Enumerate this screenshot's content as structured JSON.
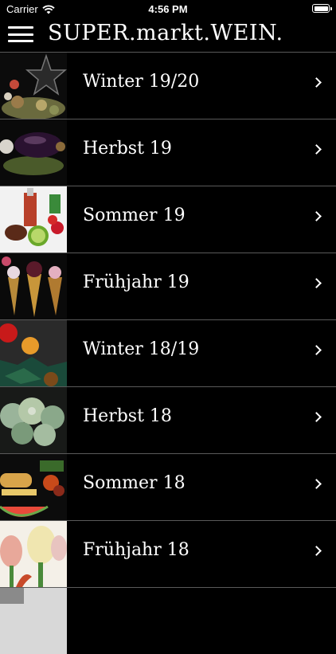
{
  "status_bar": {
    "carrier": "Carrier",
    "time": "4:56 PM"
  },
  "header": {
    "title": "SUPER.markt.WEIN."
  },
  "list": {
    "items": [
      {
        "label": "Winter 19/20"
      },
      {
        "label": "Herbst 19"
      },
      {
        "label": "Sommer 19"
      },
      {
        "label": "Frühjahr 19"
      },
      {
        "label": "Winter 18/19"
      },
      {
        "label": "Herbst 18"
      },
      {
        "label": "Sommer 18"
      },
      {
        "label": "Frühjahr 18"
      }
    ]
  },
  "icons": {
    "menu": "menu-icon",
    "wifi": "wifi-icon",
    "battery": "battery-icon",
    "chevron": "chevron-right-icon"
  },
  "colors": {
    "background": "#000000",
    "text": "#ffffff",
    "separator": "#5a5a5a"
  }
}
